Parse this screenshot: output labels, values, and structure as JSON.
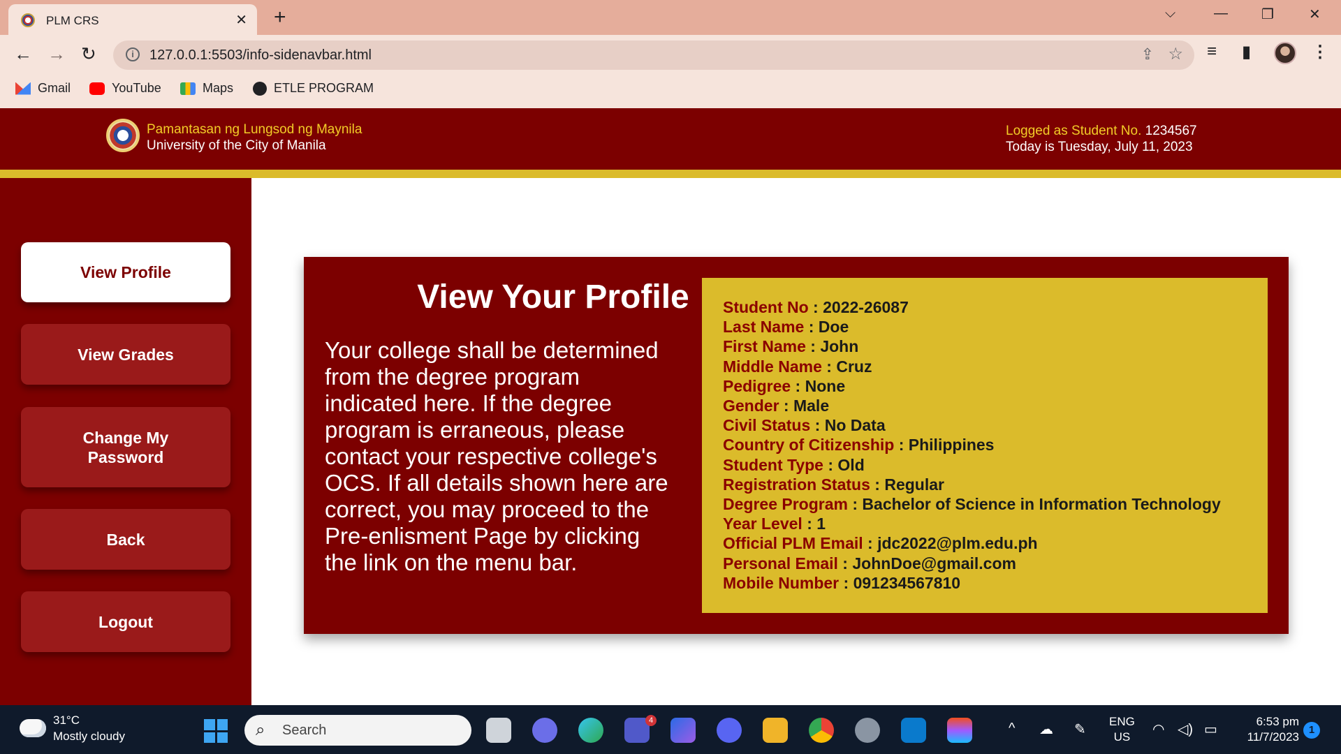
{
  "browser": {
    "tab_title": "PLM CRS",
    "url": "127.0.0.1:5503/info-sidenavbar.html",
    "bookmarks": [
      {
        "label": "Gmail",
        "icon": "gmail-icon"
      },
      {
        "label": "YouTube",
        "icon": "youtube-icon"
      },
      {
        "label": "Maps",
        "icon": "maps-icon"
      },
      {
        "label": "ETLE PROGRAM",
        "icon": "globe-icon"
      }
    ]
  },
  "header": {
    "university_tagalog": "Pamantasan ng Lungsod ng Maynila",
    "university_english": "University of the City of Manila",
    "logged_prefix": "Logged as Student No.",
    "student_no": "1234567",
    "today": "Today is Tuesday, July 11, 2023"
  },
  "sidebar": {
    "items": [
      {
        "label": "View Profile",
        "active": true
      },
      {
        "label": "View Grades",
        "active": false
      },
      {
        "label": "Change My Password",
        "active": false
      },
      {
        "label": "Back",
        "active": false
      },
      {
        "label": "Logout",
        "active": false
      }
    ]
  },
  "main": {
    "title": "View Your Profile",
    "description": "Your college shall be determined from the degree program indicated here. If the degree program is erraneous, please contact your respective college's OCS. If all details shown here are correct, you may proceed to the Pre-enlisment Page by clicking the link on the menu bar.",
    "profile": [
      {
        "label": "Student No",
        "value": "2022-26087"
      },
      {
        "label": "Last Name",
        "value": "Doe"
      },
      {
        "label": "First Name",
        "value": "John"
      },
      {
        "label": "Middle Name",
        "value": "Cruz"
      },
      {
        "label": "Pedigree",
        "value": "None"
      },
      {
        "label": "Gender",
        "value": "Male"
      },
      {
        "label": "Civil Status",
        "value": "No Data"
      },
      {
        "label": "Country of Citizenship",
        "value": "Philippines"
      },
      {
        "label": "Student Type",
        "value": "Old"
      },
      {
        "label": "Registration Status",
        "value": "Regular"
      },
      {
        "label": "Degree Program",
        "value": "Bachelor of Science in Information Technology"
      },
      {
        "label": "Year Level",
        "value": "1"
      },
      {
        "label": "Official PLM Email",
        "value": "jdc2022@plm.edu.ph"
      },
      {
        "label": "Personal Email",
        "value": "JohnDoe@gmail.com"
      },
      {
        "label": "Mobile Number",
        "value": "091234567810"
      }
    ],
    "separator": " : "
  },
  "taskbar": {
    "temperature": "31°C",
    "weather": "Mostly cloudy",
    "search_placeholder": "Search",
    "teams_badge": "4",
    "lang_line1": "ENG",
    "lang_line2": "US",
    "time": "6:53 pm",
    "date": "11/7/2023",
    "notification_count": "1"
  },
  "colors": {
    "maroon": "#7c0000",
    "button_red": "#9a1a1a",
    "gold": "#dbbb2b",
    "label_red": "#8a0000"
  }
}
